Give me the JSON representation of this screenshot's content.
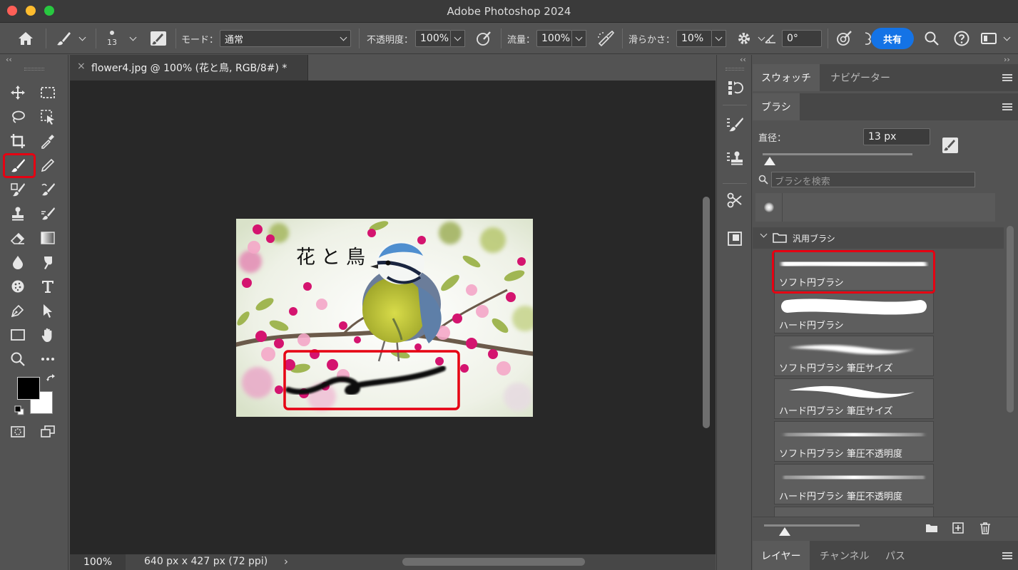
{
  "window": {
    "title": "Adobe Photoshop 2024",
    "traffic_lights": {
      "close": "#ff5f57",
      "minimize": "#febc2e",
      "zoom": "#28c840"
    }
  },
  "options_bar": {
    "brush_size": "13",
    "mode_label": "モード：",
    "mode_value": "通常",
    "opacity_label": "不透明度：",
    "opacity_value": "100%",
    "flow_label": "流量：",
    "flow_value": "100%",
    "smoothing_label": "滑らかさ：",
    "smoothing_value": "10%",
    "angle_value": "0°",
    "share_label": "共有",
    "share_color": "#1473e6"
  },
  "document": {
    "tab_title": "flower4.jpg @ 100% (花と鳥, RGB/8#) *",
    "image_text": "花と鳥",
    "zoom": "100%",
    "info": "640 px x 427 px (72 ppi)"
  },
  "tools": {
    "foreground_color": "#000000",
    "background_color": "#ffffff"
  },
  "swatches_panel": {
    "tabs": [
      "スウォッチ",
      "ナビゲーター"
    ]
  },
  "brush_panel": {
    "tab": "ブラシ",
    "diameter_label": "直径：",
    "diameter_value": "13 px",
    "search_placeholder": "ブラシを検索",
    "folder_name": "汎用ブラシ",
    "brushes": [
      "ソフト円ブラシ",
      "ハード円ブラシ",
      "ソフト円ブラシ 筆圧サイズ",
      "ハード円ブラシ 筆圧サイズ",
      "ソフト円ブラシ 筆圧不透明度",
      "ハード円ブラシ 筆圧不透明度"
    ]
  },
  "layers_panel": {
    "tabs": [
      "レイヤー",
      "チャンネル",
      "パス"
    ]
  },
  "highlight_color": "#e60012"
}
